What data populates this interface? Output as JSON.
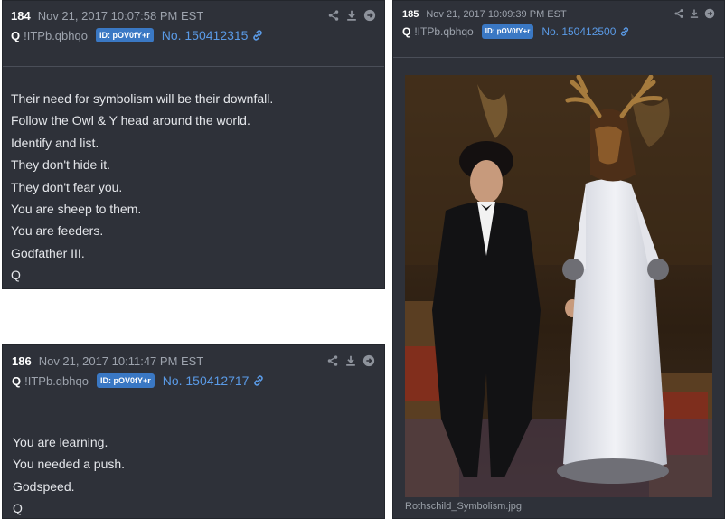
{
  "posts": [
    {
      "number": "184",
      "date": "Nov 21, 2017 10:07:58 PM EST",
      "author": "Q",
      "tripcode": "!ITPb.qbhqo",
      "id_badge": "ID: pOV0fY+r",
      "post_no": "No. 150412315",
      "body": [
        "Their need for symbolism will be their downfall.",
        "Follow the Owl & Y head around the world.",
        "Identify and list.",
        "They don't hide it.",
        "They don't fear you.",
        "You are sheep to them.",
        "You are feeders.",
        "Godfather III.",
        "Q"
      ]
    },
    {
      "number": "185",
      "date": "Nov 21, 2017 10:09:39 PM EST",
      "author": "Q",
      "tripcode": "!ITPb.qbhqo",
      "id_badge": "ID: pOV0fY+r",
      "post_no": "No. 150412500",
      "image_filename": "Rothschild_Symbolism.jpg"
    },
    {
      "number": "186",
      "date": "Nov 21, 2017 10:11:47 PM EST",
      "author": "Q",
      "tripcode": "!ITPb.qbhqo",
      "id_badge": "ID: pOV0fY+r",
      "post_no": "No. 150412717",
      "body": [
        "You are learning.",
        "You needed a push.",
        "Godspeed.",
        "Q"
      ]
    }
  ],
  "icons": [
    "share-icon",
    "download-icon",
    "go-arrow-icon",
    "link-icon"
  ],
  "colors": {
    "card_bg": "#2e3139",
    "accent_blue": "#3a78c4",
    "link_blue": "#5a9ae6",
    "muted": "#9da3ad"
  }
}
